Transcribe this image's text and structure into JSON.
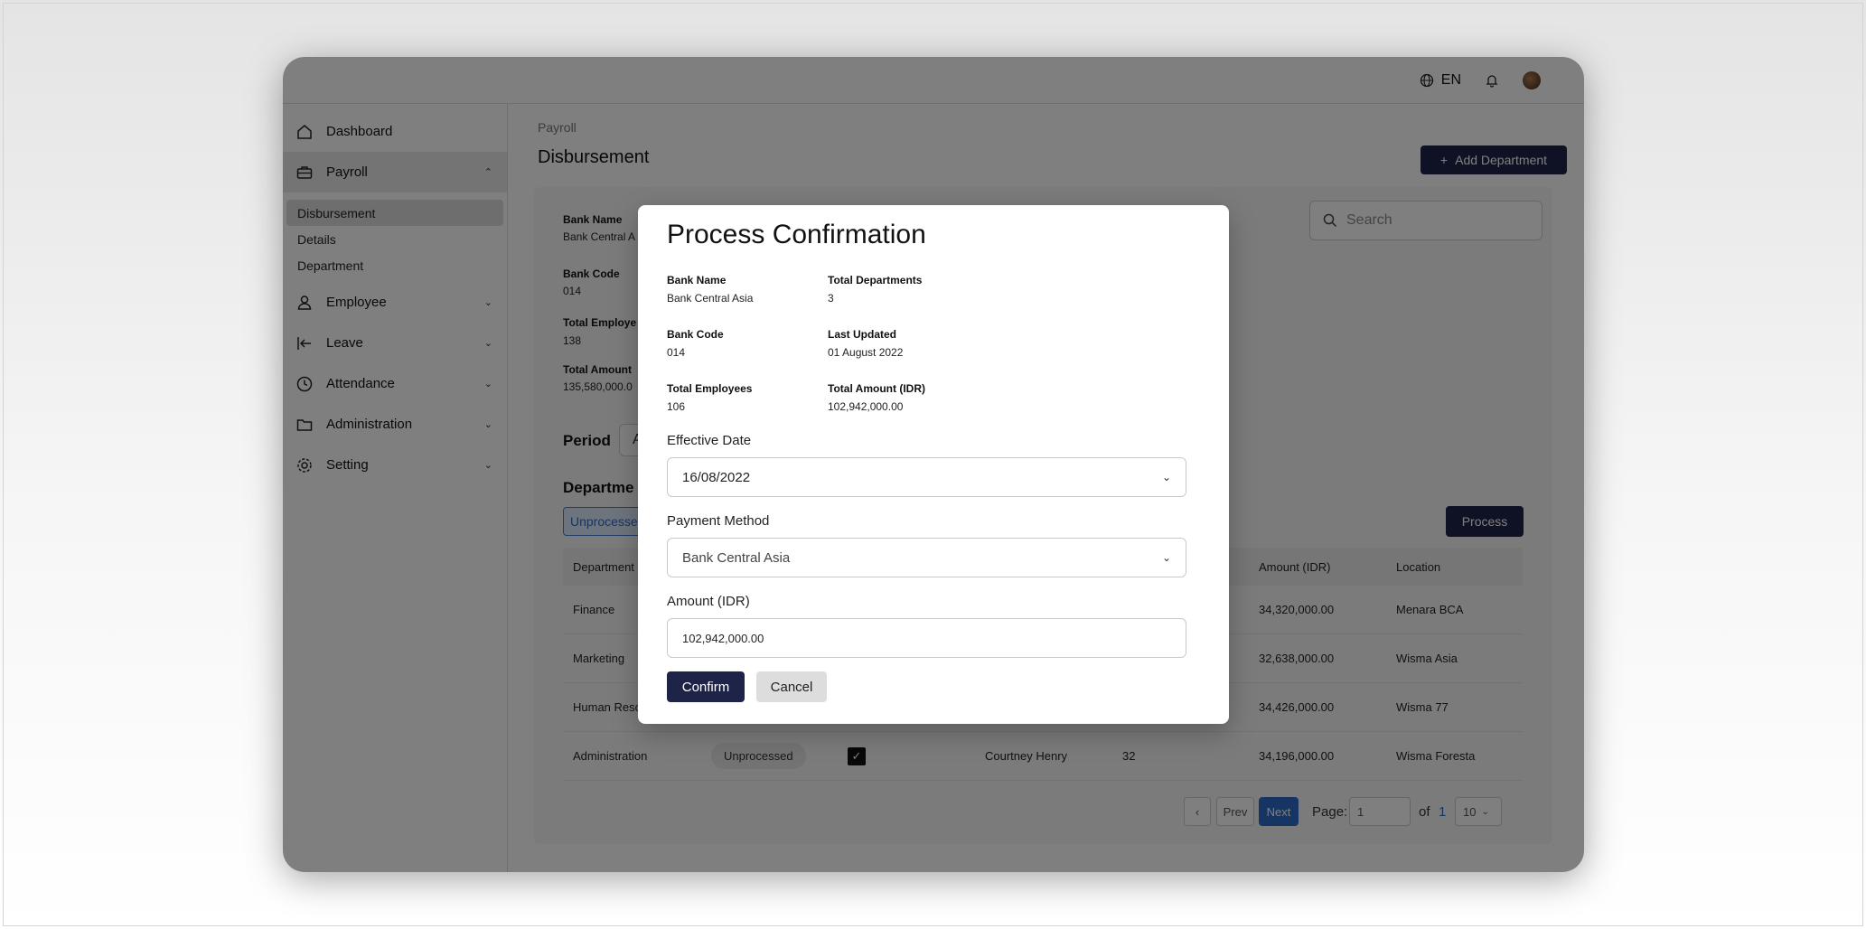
{
  "topbar": {
    "language": "EN"
  },
  "sidebar": {
    "items": [
      {
        "label": "Dashboard"
      },
      {
        "label": "Payroll"
      },
      {
        "label": "Employee"
      },
      {
        "label": "Leave"
      },
      {
        "label": "Attendance"
      },
      {
        "label": "Administration"
      },
      {
        "label": "Setting"
      }
    ],
    "payroll_sub": [
      "Disbursement",
      "Details",
      "Department"
    ]
  },
  "main": {
    "breadcrumb": "Payroll",
    "title": "Disbursement",
    "add_button": "Add Department",
    "info": {
      "bank_name_label": "Bank Name",
      "bank_name_value": "Bank Central A",
      "bank_code_label": "Bank Code",
      "bank_code_value": "014",
      "total_employees_label": "Total Employe",
      "total_employees_value": "138",
      "total_amount_label": "Total Amount",
      "total_amount_value": "135,580,000.0"
    },
    "search_placeholder": "Search",
    "period_label": "Period",
    "period_value": "A",
    "departments_heading": "Departme",
    "tab_label": "Unprocesse",
    "process_button": "Process",
    "table": {
      "headers": [
        "Department",
        "Amount (IDR)",
        "Location"
      ],
      "rows": [
        {
          "department": "Finance",
          "amount": "34,320,000.00",
          "location": "Menara BCA"
        },
        {
          "department": "Marketing",
          "amount": "32,638,000.00",
          "location": "Wisma Asia"
        },
        {
          "department": "Human Reso",
          "amount": "34,426,000.00",
          "location": "Wisma 77"
        },
        {
          "department": "Administration",
          "status": "Unprocessed",
          "manager": "Courtney Henry",
          "employees": "32",
          "amount": "34,196,000.00",
          "location": "Wisma Foresta"
        }
      ]
    },
    "pagination": {
      "prev": "Prev",
      "next": "Next",
      "page_label": "Page:",
      "page_value": "1",
      "of_label": "of",
      "total_pages": "1",
      "page_size": "10"
    }
  },
  "modal": {
    "title": "Process Confirmation",
    "bank_name_label": "Bank Name",
    "bank_name_value": "Bank Central Asia",
    "total_departments_label": "Total Departments",
    "total_departments_value": "3",
    "bank_code_label": "Bank Code",
    "bank_code_value": "014",
    "last_updated_label": "Last Updated",
    "last_updated_value": "01 August 2022",
    "total_employees_label": "Total Employees",
    "total_employees_value": "106",
    "total_amount_label": "Total Amount (IDR)",
    "total_amount_value": "102,942,000.00",
    "effective_date_label": "Effective Date",
    "effective_date_value": "16/08/2022",
    "payment_method_label": "Payment Method",
    "payment_method_value": "Bank Central Asia",
    "amount_label": "Amount (IDR)",
    "amount_value": "102,942,000.00",
    "confirm": "Confirm",
    "cancel": "Cancel"
  }
}
